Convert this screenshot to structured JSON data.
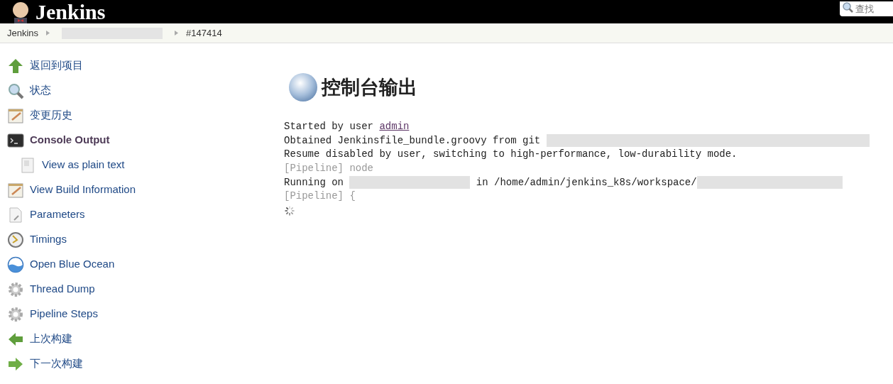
{
  "header": {
    "title": "Jenkins",
    "search": {
      "placeholder": "查找"
    }
  },
  "breadcrumbs": [
    {
      "kind": "link",
      "text": "Jenkins"
    },
    {
      "kind": "redacted"
    },
    {
      "kind": "link",
      "text": "#147414"
    }
  ],
  "sidebar": {
    "items": [
      {
        "kind": "up",
        "label": "返回到项目",
        "selected": false
      },
      {
        "kind": "search",
        "label": "状态",
        "selected": false
      },
      {
        "kind": "notepad",
        "label": "变更历史",
        "selected": false
      },
      {
        "kind": "terminal",
        "label": "Console Output",
        "selected": true,
        "children": [
          {
            "kind": "document",
            "label": "View as plain text",
            "selected": false
          }
        ]
      },
      {
        "kind": "notepad",
        "label": "View Build Information",
        "selected": false
      },
      {
        "kind": "params",
        "label": "Parameters",
        "selected": false
      },
      {
        "kind": "clock",
        "label": "Timings",
        "selected": false
      },
      {
        "kind": "ocean",
        "label": "Open Blue Ocean",
        "selected": false
      },
      {
        "kind": "gear",
        "label": "Thread Dump",
        "selected": false
      },
      {
        "kind": "gear",
        "label": "Pipeline Steps",
        "selected": false
      },
      {
        "kind": "left",
        "label": "上次构建",
        "selected": false
      },
      {
        "kind": "right",
        "label": "下一次构建",
        "selected": false
      }
    ]
  },
  "main": {
    "title": "控制台输出",
    "console": [
      [
        {
          "kind": "text",
          "text": "Started by user "
        },
        {
          "kind": "link",
          "text": "admin"
        }
      ],
      [
        {
          "kind": "text",
          "text": "Obtained Jenkinsfile_bundle.groovy from git "
        },
        {
          "kind": "redacted"
        }
      ],
      [
        {
          "kind": "text",
          "text": "Resume disabled by user, switching to high-performance, low-durability mode."
        }
      ],
      [
        {
          "kind": "muted",
          "text": "[Pipeline] node"
        }
      ],
      [
        {
          "kind": "text",
          "text": "Running on "
        },
        {
          "kind": "redacted"
        },
        {
          "kind": "text",
          "text": " in /home/admin/jenkins_k8s/workspace/"
        },
        {
          "kind": "redacted"
        }
      ],
      [
        {
          "kind": "muted",
          "text": "[Pipeline] {"
        }
      ]
    ],
    "loading": true
  }
}
